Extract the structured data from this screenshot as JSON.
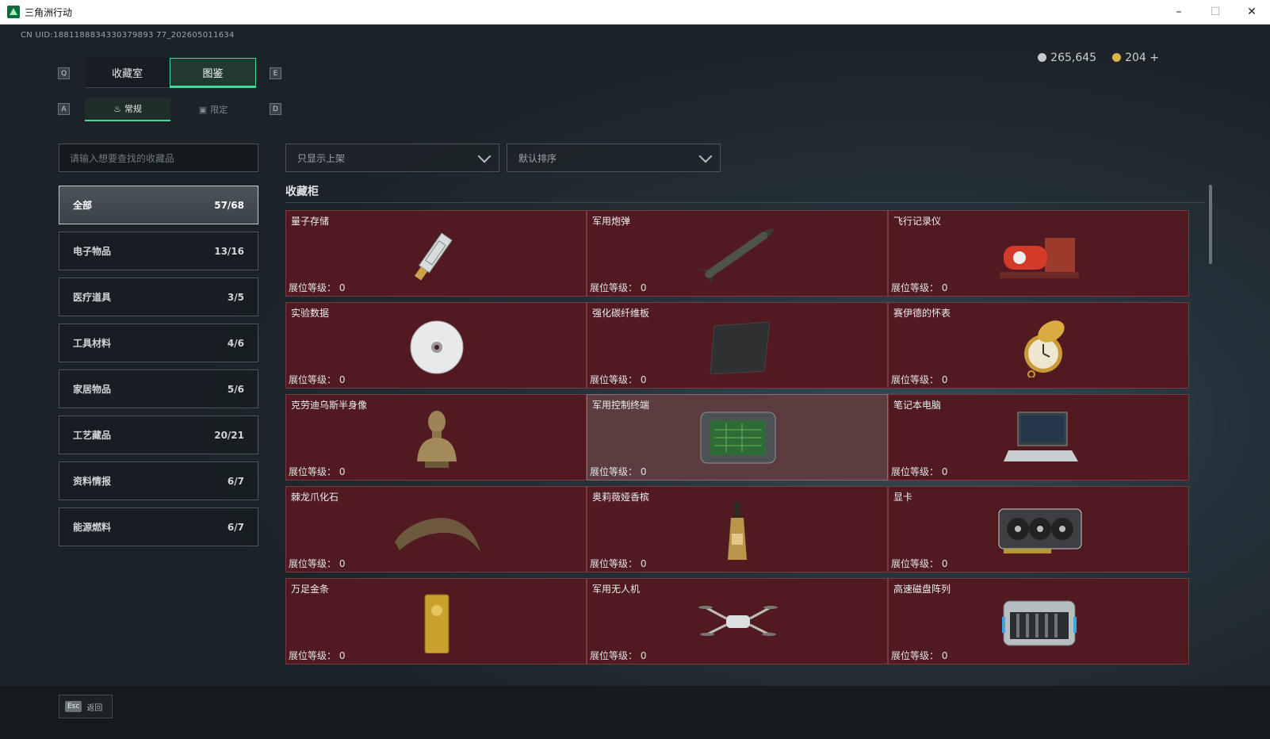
{
  "window": {
    "title": "三角洲行动",
    "app_icon": "game-logo-icon"
  },
  "uid": "CN UID:1881188834330379893 77_202605011634",
  "keys": {
    "tab_prev": "Q",
    "tab_next": "E",
    "sub_prev": "A",
    "sub_next": "D"
  },
  "tabs": [
    {
      "label": "收藏室",
      "active": false
    },
    {
      "label": "图鉴",
      "active": true
    }
  ],
  "subtabs": [
    {
      "label": "常规",
      "icon": "flame-icon",
      "active": true
    },
    {
      "label": "限定",
      "icon": "image-icon",
      "active": false
    }
  ],
  "currency": {
    "silver": "265,645",
    "gold": "204",
    "add_label": "+",
    "silver_color": "#c7c9ca",
    "gold_color": "#d9b24a"
  },
  "search": {
    "placeholder": "请输入想要查找的收藏品"
  },
  "filters": {
    "shelf": "只显示上架",
    "sort": "默认排序"
  },
  "categories": [
    {
      "label": "全部",
      "count": "57/68",
      "active": true
    },
    {
      "label": "电子物品",
      "count": "13/16"
    },
    {
      "label": "医疗道具",
      "count": "3/5"
    },
    {
      "label": "工具材料",
      "count": "4/6"
    },
    {
      "label": "家居物品",
      "count": "5/6"
    },
    {
      "label": "工艺藏品",
      "count": "20/21"
    },
    {
      "label": "资料情报",
      "count": "6/7"
    },
    {
      "label": "能源燃料",
      "count": "6/7"
    }
  ],
  "section_title": "收藏柜",
  "level_label": "展位等级：",
  "items": [
    {
      "name": "量子存储",
      "level": "0",
      "icon": "usb-drive-icon"
    },
    {
      "name": "军用炮弹",
      "level": "0",
      "icon": "missile-icon"
    },
    {
      "name": "飞行记录仪",
      "level": "0",
      "icon": "flight-recorder-icon"
    },
    {
      "name": "实验数据",
      "level": "0",
      "icon": "disc-icon"
    },
    {
      "name": "强化碳纤维板",
      "level": "0",
      "icon": "carbon-plate-icon"
    },
    {
      "name": "赛伊德的怀表",
      "level": "0",
      "icon": "pocket-watch-icon"
    },
    {
      "name": "克劳迪乌斯半身像",
      "level": "0",
      "icon": "bust-icon"
    },
    {
      "name": "军用控制终端",
      "level": "0",
      "icon": "control-terminal-icon",
      "highlighted": true
    },
    {
      "name": "笔记本电脑",
      "level": "0",
      "icon": "laptop-icon"
    },
    {
      "name": "棘龙爪化石",
      "level": "0",
      "icon": "claw-fossil-icon"
    },
    {
      "name": "奥莉薇娅香槟",
      "level": "0",
      "icon": "champagne-icon"
    },
    {
      "name": "显卡",
      "level": "0",
      "icon": "graphics-card-icon"
    },
    {
      "name": "万足金条",
      "level": "0",
      "icon": "gold-bar-icon"
    },
    {
      "name": "军用无人机",
      "level": "0",
      "icon": "drone-icon"
    },
    {
      "name": "高速磁盘阵列",
      "level": "0",
      "icon": "disk-array-icon"
    }
  ],
  "bottom": {
    "esc_key": "Esc",
    "esc_label": "返回"
  }
}
